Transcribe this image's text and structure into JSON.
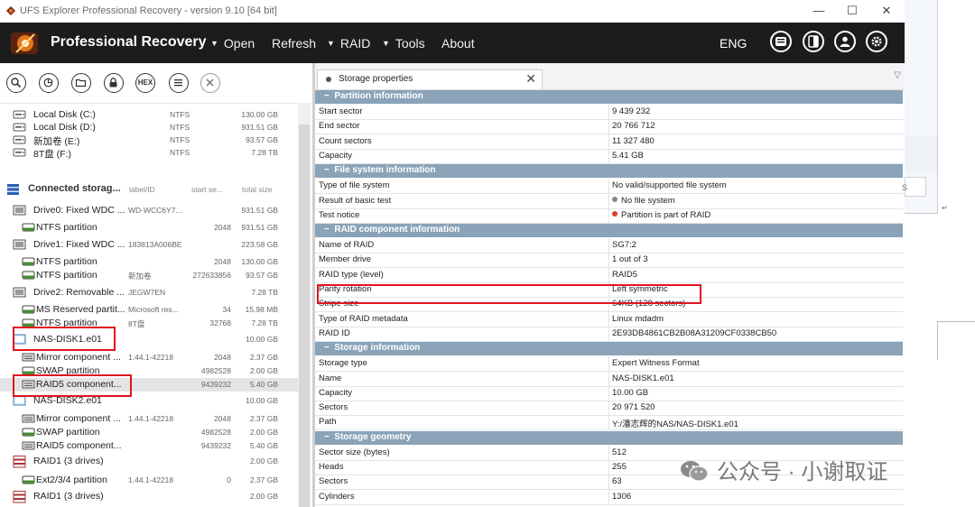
{
  "window": {
    "title": "UFS Explorer Professional Recovery - version 9.10 [64 bit]",
    "controls": {
      "minimize": "—",
      "maximize": "☐",
      "close": "✕"
    }
  },
  "menubar": {
    "brand": "Professional Recovery",
    "items": [
      {
        "label": "Open",
        "caret": true
      },
      {
        "label": "Refresh",
        "caret": false
      },
      {
        "label": "RAID",
        "caret": true
      },
      {
        "label": "Tools",
        "caret": true
      },
      {
        "label": "About",
        "caret": false
      }
    ],
    "language": "ENG",
    "right_icons": [
      "panel-icon",
      "layout-icon",
      "user-icon",
      "settings-icon"
    ]
  },
  "toolbar": {
    "hex_label": "HEX",
    "icons": [
      "search-icon",
      "scan-icon",
      "folder-icon",
      "lock-icon",
      "hex-icon",
      "list-icon",
      "close-icon"
    ]
  },
  "left_panel": {
    "local_disks": [
      {
        "name": "Local Disk (C:)",
        "fs": "NTFS",
        "size": "130.00 GB"
      },
      {
        "name": "Local Disk (D:)",
        "fs": "NTFS",
        "size": "931.51 GB"
      },
      {
        "name": "新加卷 (E:)",
        "fs": "NTFS",
        "size": "93.57 GB"
      },
      {
        "name": "8T盘 (F:)",
        "fs": "NTFS",
        "size": "7.28 TB"
      }
    ],
    "connected_header": {
      "title": "Connected storag...",
      "col_label": "label/ID",
      "col_start": "start se...",
      "col_size": "total size"
    },
    "items": [
      {
        "name": "Drive0: Fixed WDC ...",
        "label": "WD-WCC6Y7...",
        "start": "",
        "size": "931.51 GB",
        "icon": "drive",
        "indent": 14
      },
      {
        "name": "NTFS partition",
        "label": "",
        "start": "2048",
        "size": "931.51 GB",
        "icon": "partition",
        "indent": 24
      },
      {
        "name": "Drive1: Fixed WDC ...",
        "label": "183813A006BE",
        "start": "",
        "size": "223.58 GB",
        "icon": "drive",
        "indent": 14
      },
      {
        "name": "NTFS partition",
        "label": "",
        "start": "2048",
        "size": "130.00 GB",
        "icon": "partition",
        "indent": 24
      },
      {
        "name": "NTFS partition",
        "label": "新加卷",
        "start": "272633856",
        "size": "93.57 GB",
        "icon": "partition",
        "indent": 24
      },
      {
        "name": "Drive2: Removable ...",
        "label": "JEGW7EN",
        "start": "",
        "size": "7.28 TB",
        "icon": "drive",
        "indent": 14
      },
      {
        "name": "MS Reserved partit...",
        "label": "Microsoft res...",
        "start": "34",
        "size": "15.98 MB",
        "icon": "partition",
        "indent": 24
      },
      {
        "name": "NTFS partition",
        "label": "8T盘",
        "start": "32768",
        "size": "7.28 TB",
        "icon": "partition",
        "indent": 24
      },
      {
        "name": "NAS-DISK1.e01",
        "label": "",
        "start": "",
        "size": "10.00 GB",
        "icon": "image",
        "indent": 14
      },
      {
        "name": "Mirror component ...",
        "label": "1.44.1-42218",
        "start": "2048",
        "size": "2.37 GB",
        "icon": "component",
        "indent": 24
      },
      {
        "name": "SWAP partition",
        "label": "",
        "start": "4982528",
        "size": "2.00 GB",
        "icon": "partition",
        "indent": 24
      },
      {
        "name": "RAID5 component...",
        "label": "",
        "start": "9439232",
        "size": "5.40 GB",
        "icon": "component",
        "indent": 24,
        "selected": true
      },
      {
        "name": "NAS-DISK2.e01",
        "label": "",
        "start": "",
        "size": "10.00 GB",
        "icon": "image",
        "indent": 14
      },
      {
        "name": "Mirror component ...",
        "label": "1.44.1-42218",
        "start": "2048",
        "size": "2.37 GB",
        "icon": "component",
        "indent": 24
      },
      {
        "name": "SWAP partition",
        "label": "",
        "start": "4982528",
        "size": "2.00 GB",
        "icon": "partition",
        "indent": 24
      },
      {
        "name": "RAID5 component...",
        "label": "",
        "start": "9439232",
        "size": "5.40 GB",
        "icon": "component",
        "indent": 24
      },
      {
        "name": "RAID1 (3 drives)",
        "label": "",
        "start": "",
        "size": "2.00 GB",
        "icon": "raid",
        "indent": 14
      },
      {
        "name": "Ext2/3/4 partition",
        "label": "1.44.1-42218",
        "start": "0",
        "size": "2.37 GB",
        "icon": "partition",
        "indent": 24
      },
      {
        "name": "RAID1 (3 drives)",
        "label": "",
        "start": "",
        "size": "2.00 GB",
        "icon": "raid",
        "indent": 14
      }
    ]
  },
  "storage_properties": {
    "tab_label": "Storage properties",
    "sections": [
      {
        "title": "Partition information",
        "rows": [
          {
            "key": "Start sector",
            "value": "9 439 232"
          },
          {
            "key": "End sector",
            "value": "20 766 712"
          },
          {
            "key": "Count sectors",
            "value": "11 327 480"
          },
          {
            "key": "Capacity",
            "value": "5.41 GB"
          }
        ]
      },
      {
        "title": "File system information",
        "rows": [
          {
            "key": "Type of file system",
            "value": "No valid/supported file system"
          },
          {
            "key": "Result of basic test",
            "value": "No file system",
            "status": "grey"
          },
          {
            "key": "Test notice",
            "value": "Partition is part of RAID",
            "status": "red"
          }
        ]
      },
      {
        "title": "RAID component information",
        "rows": [
          {
            "key": "Name of RAID",
            "value": "SG7:2"
          },
          {
            "key": "Member drive",
            "value": "1 out of 3"
          },
          {
            "key": "RAID type (level)",
            "value": "RAID5"
          },
          {
            "key": "Parity rotation",
            "value": "Left symmetric"
          },
          {
            "key": "Stripe size",
            "value": "64KB (128 sectors)"
          },
          {
            "key": "Type of RAID metadata",
            "value": "Linux mdadm"
          },
          {
            "key": "RAID ID",
            "value": "2E93DB4861CB2B08A31209CF0338CB50"
          }
        ]
      },
      {
        "title": "Storage information",
        "rows": [
          {
            "key": "Storage type",
            "value": "Expert Witness Format"
          },
          {
            "key": "Name",
            "value": "NAS-DISK1.e01"
          },
          {
            "key": "Capacity",
            "value": "10.00 GB"
          },
          {
            "key": "Sectors",
            "value": "20 971 520"
          },
          {
            "key": "Path",
            "value": "Y:/潘志辉的NAS/NAS-DISK1.e01"
          }
        ]
      },
      {
        "title": "Storage geometry",
        "rows": [
          {
            "key": "Sector size (bytes)",
            "value": "512"
          },
          {
            "key": "Heads",
            "value": "255"
          },
          {
            "key": "Sectors",
            "value": "63"
          },
          {
            "key": "Cylinders",
            "value": "1306"
          }
        ]
      }
    ]
  },
  "watermark": {
    "text": "公众号 · 小谢取证"
  },
  "background_window": {
    "glyph": "↵",
    "small": "S"
  },
  "colors": {
    "menubar": "#1c1c1c",
    "section_header": "#8aa3b8",
    "highlight_red": "#e0141e",
    "status_red": "#e03a2f",
    "status_grey": "#888888"
  }
}
